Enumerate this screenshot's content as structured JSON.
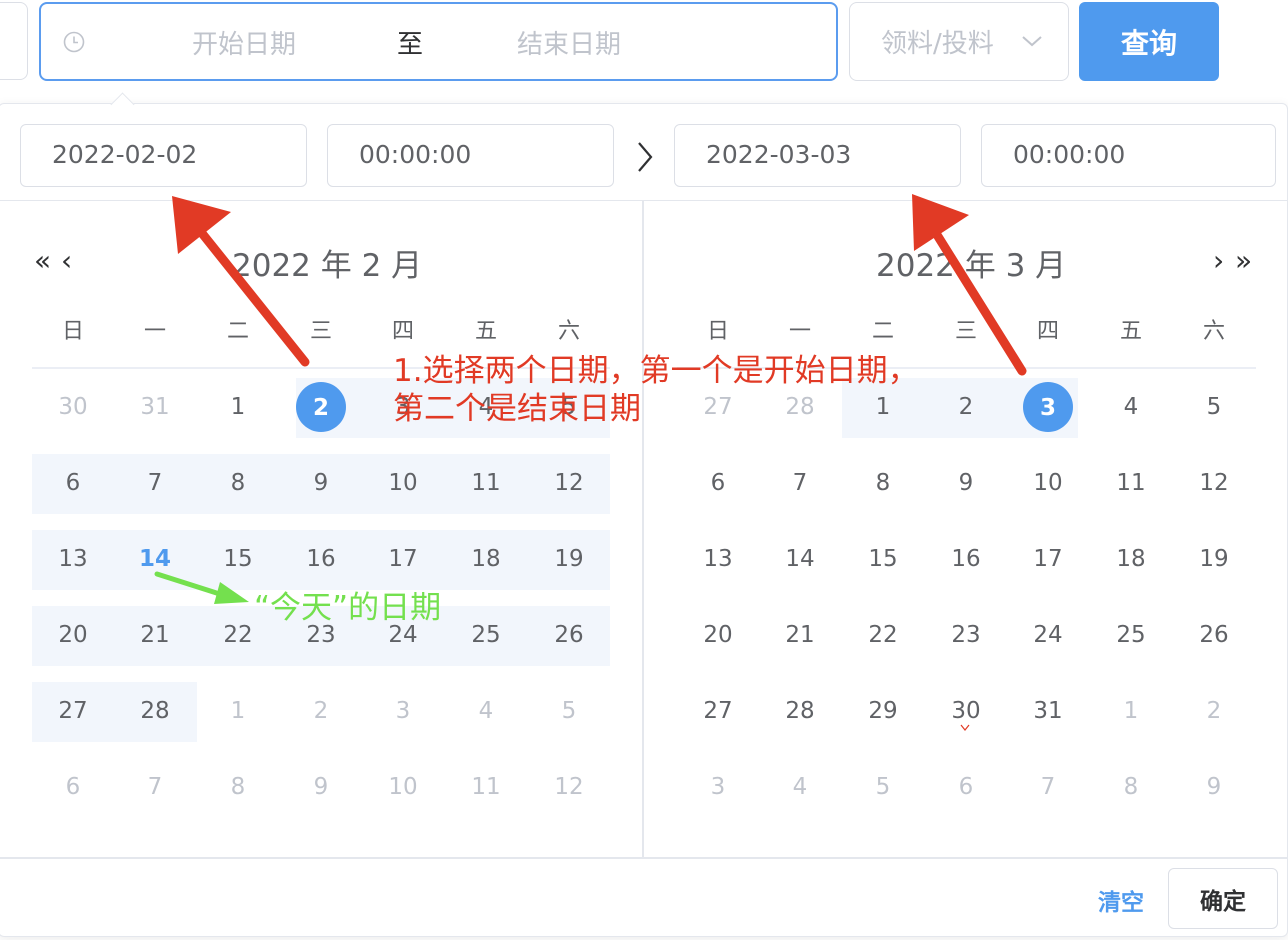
{
  "query_bar": {
    "start_placeholder": "开始日期",
    "range_separator": "至",
    "end_placeholder": "结束日期",
    "type_select_value": "领料/投料",
    "query_button": "查询",
    "icons": {
      "clock": "clock-icon",
      "select_arrow": "chevron-down-icon"
    }
  },
  "picker": {
    "start_date": "2022-02-02",
    "start_time": "00:00:00",
    "end_date": "2022-03-03",
    "end_time": "00:00:00",
    "left_title": "2022 年 2 月",
    "right_title": "2022 年 3 月",
    "nav": {
      "prev_year": "«",
      "prev_month": "‹",
      "next_month": "›",
      "next_year": "»"
    },
    "weekdays": [
      "日",
      "一",
      "二",
      "三",
      "四",
      "五",
      "六"
    ],
    "left_rows": [
      [
        "30",
        "31",
        "1",
        "2",
        "3",
        "4",
        "5"
      ],
      [
        "6",
        "7",
        "8",
        "9",
        "10",
        "11",
        "12"
      ],
      [
        "13",
        "14",
        "15",
        "16",
        "17",
        "18",
        "19"
      ],
      [
        "20",
        "21",
        "22",
        "23",
        "24",
        "25",
        "26"
      ],
      [
        "27",
        "28",
        "1",
        "2",
        "3",
        "4",
        "5"
      ],
      [
        "6",
        "7",
        "8",
        "9",
        "10",
        "11",
        "12"
      ]
    ],
    "right_rows": [
      [
        "27",
        "28",
        "1",
        "2",
        "3",
        "4",
        "5"
      ],
      [
        "6",
        "7",
        "8",
        "9",
        "10",
        "11",
        "12"
      ],
      [
        "13",
        "14",
        "15",
        "16",
        "17",
        "18",
        "19"
      ],
      [
        "20",
        "21",
        "22",
        "23",
        "24",
        "25",
        "26"
      ],
      [
        "27",
        "28",
        "29",
        "30",
        "31",
        "1",
        "2"
      ],
      [
        "3",
        "4",
        "5",
        "6",
        "7",
        "8",
        "9"
      ]
    ],
    "today": "14",
    "selected_start": "2",
    "selected_end": "3",
    "clear_label": "清空",
    "confirm_label": "确定"
  },
  "annotations": {
    "red_line1": "1.选择两个日期，第一个是开始日期，",
    "red_line2": "第二个是结束日期",
    "green": "“今天”的日期"
  },
  "colors": {
    "accent": "#4f9aee",
    "range_band": "#f2f6fc",
    "annotation_red": "#e13a25",
    "annotation_green": "#74e04e"
  }
}
